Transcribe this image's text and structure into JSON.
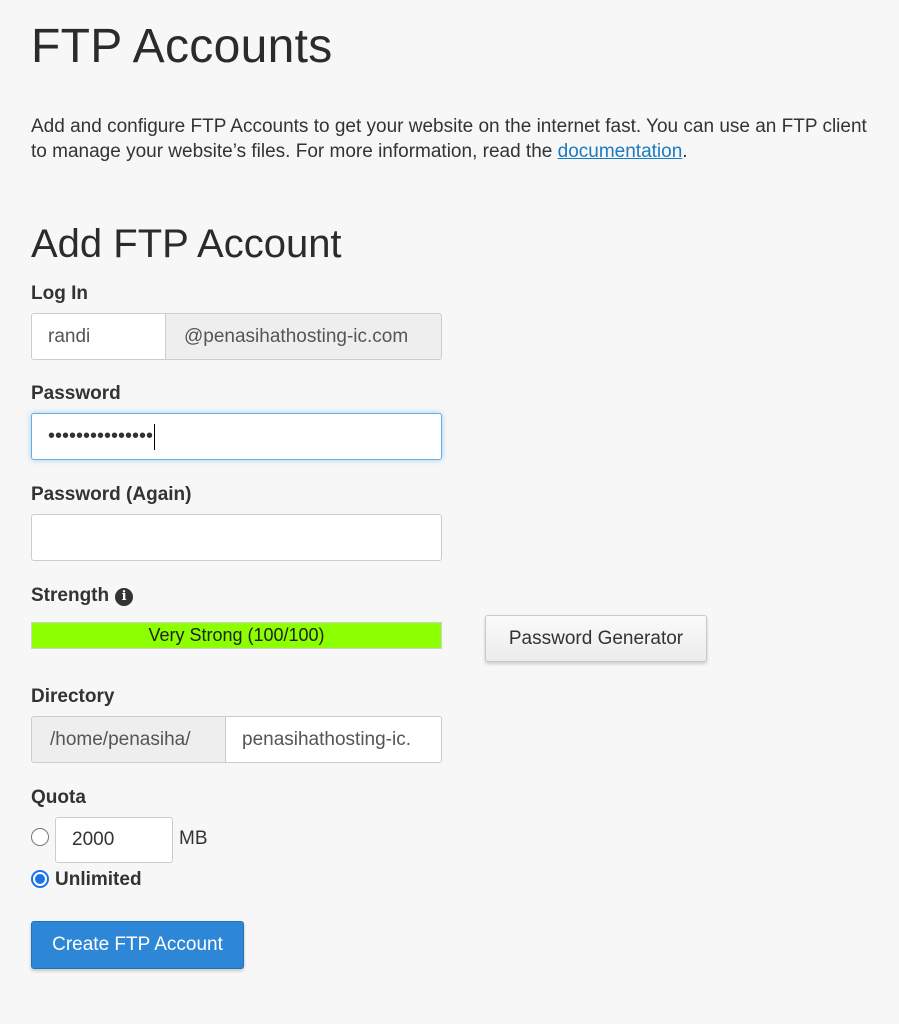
{
  "page": {
    "title": "FTP Accounts",
    "intro_text": "Add and configure FTP Accounts to get your website on the internet fast. You can use an FTP client to manage your website’s files. For more information, read the ",
    "intro_link": "documentation",
    "intro_end": "."
  },
  "form": {
    "section_title": "Add FTP Account",
    "login": {
      "label": "Log In",
      "value": "randi",
      "domain": "@penasihathosting-ic.com"
    },
    "password": {
      "label": "Password",
      "value": "•••••••••••••••"
    },
    "password_again": {
      "label": "Password (Again)",
      "value": ""
    },
    "strength": {
      "label": "Strength",
      "info_icon": "info-circle-icon",
      "text": "Very Strong (100/100)",
      "score": 100,
      "color": "#8cff00"
    },
    "password_generator_label": "Password Generator",
    "directory": {
      "label": "Directory",
      "prefix": "/home/penasiha/",
      "value": "penasihathosting-ic."
    },
    "quota": {
      "label": "Quota",
      "limited_value": "2000",
      "unit": "MB",
      "unlimited_label": "Unlimited",
      "selected": "unlimited"
    },
    "submit_label": "Create FTP Account"
  },
  "colors": {
    "accent": "#2d87d6",
    "link": "#1a7bbf",
    "focus_border": "#66afe9"
  }
}
